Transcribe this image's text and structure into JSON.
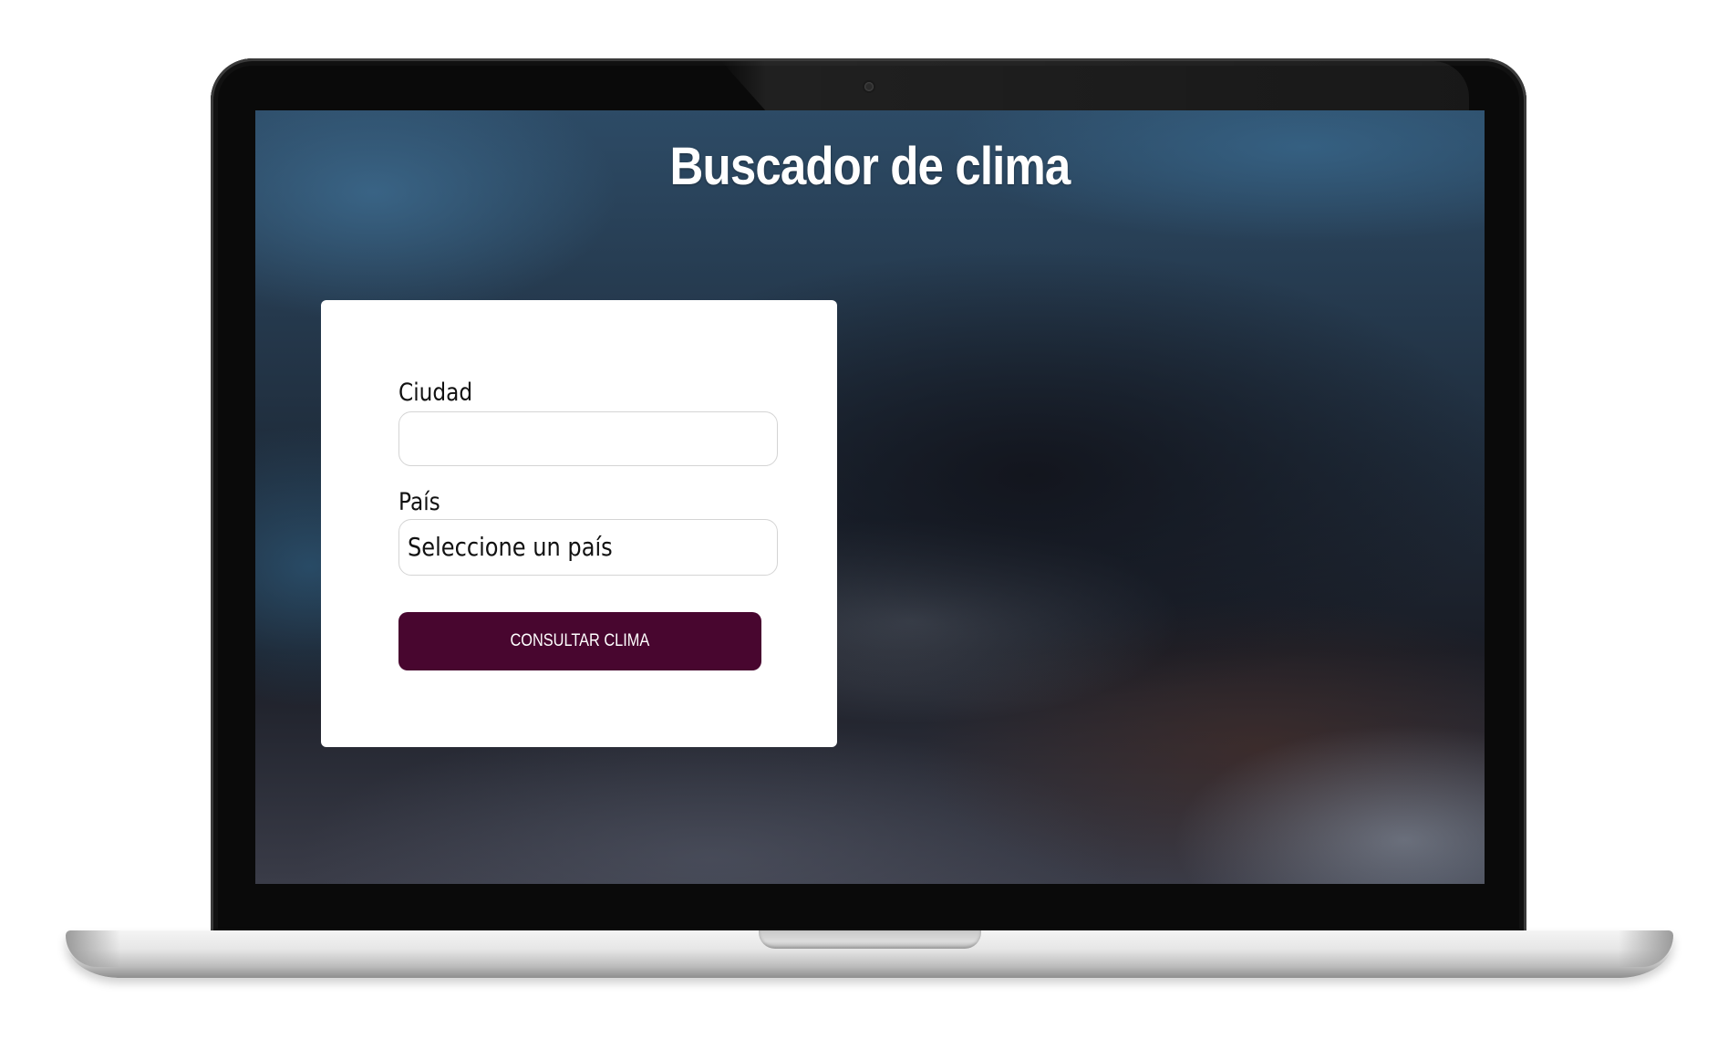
{
  "app": {
    "title": "Buscador de clima"
  },
  "form": {
    "city_label": "Ciudad",
    "city_value": "",
    "country_label": "País",
    "country_selected": "Seleccione un país",
    "submit_label": "CONSULTAR CLIMA"
  },
  "colors": {
    "button_background": "#48062f",
    "card_background": "#ffffff",
    "title_color": "#ffffff"
  }
}
